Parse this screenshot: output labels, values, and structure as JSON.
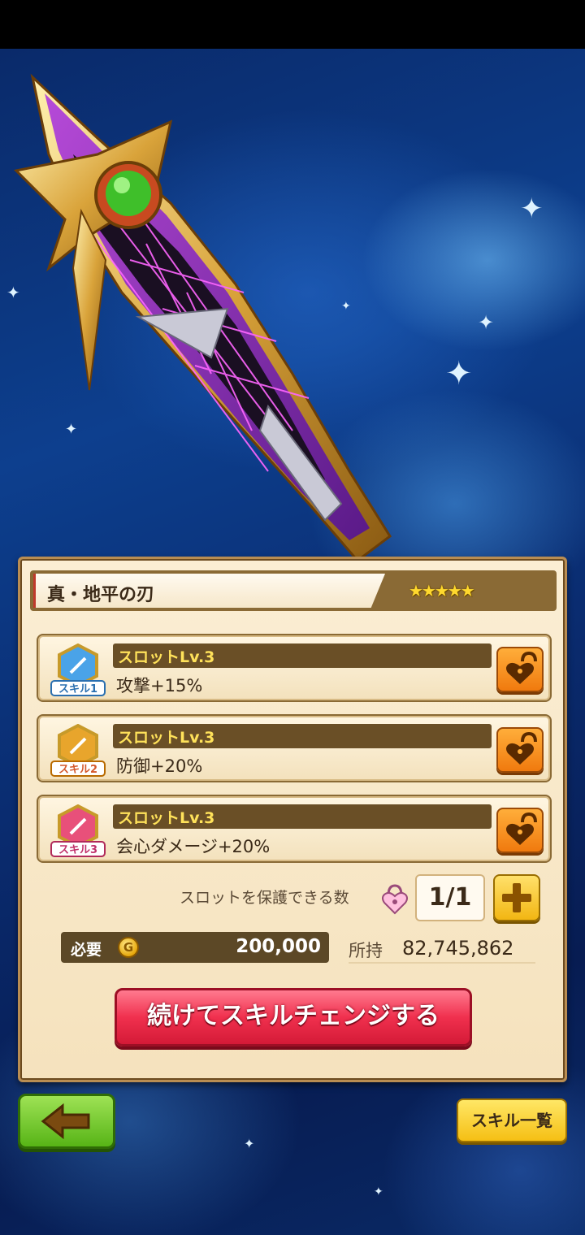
{
  "weapon": {
    "name": "真・地平の刃",
    "stars": "★★★★★"
  },
  "slots": [
    {
      "badge": "スキル1",
      "level": "スロットLv.3",
      "effect": "攻撃+15%",
      "badge_color": "#4aa3e8"
    },
    {
      "badge": "スキル2",
      "level": "スロットLv.3",
      "effect": "防御+20%",
      "badge_color": "#e8a52c"
    },
    {
      "badge": "スキル3",
      "level": "スロットLv.3",
      "effect": "会心ダメージ+20%",
      "badge_color": "#e8507a"
    }
  ],
  "protect": {
    "label": "スロットを保護できる数",
    "count": "1/1"
  },
  "cost": {
    "label": "必要",
    "currency_icon": "G",
    "value": "200,000"
  },
  "owned": {
    "label": "所持",
    "value": "82,745,862"
  },
  "buttons": {
    "change": "続けてスキルチェンジする",
    "skill_list": "スキル一覧"
  },
  "colors": {
    "panel_bg": "#f5e2bd",
    "change_button": "#f0304e",
    "back_button": "#57b416",
    "lock_button": "#f07a0e",
    "skill_list_button": "#f5bf14"
  }
}
